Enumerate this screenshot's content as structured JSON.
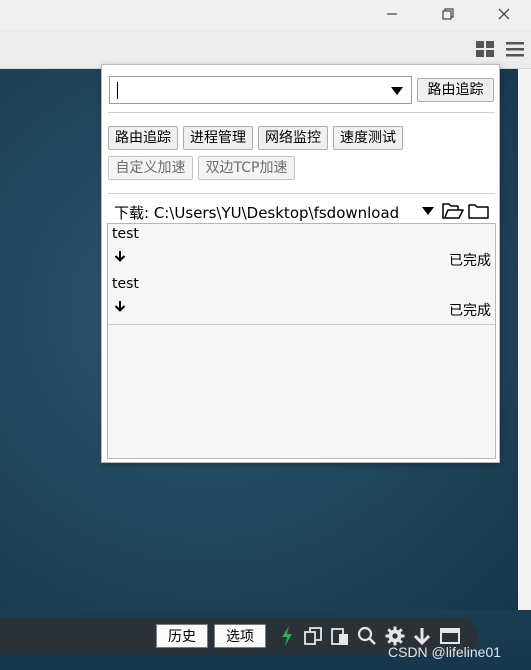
{
  "panel": {
    "route_button": "路由追踪",
    "tools": [
      "路由追踪",
      "进程管理",
      "网络监控",
      "速度测试"
    ],
    "tools_disabled": [
      "自定义加速",
      "双边TCP加速"
    ],
    "download_label": "下载: C:\\Users\\YU\\Desktop\\fsdownload",
    "items": [
      {
        "name": "test",
        "status": "已完成"
      },
      {
        "name": "test",
        "status": "已完成"
      }
    ]
  },
  "taskbar": {
    "history_label": "历史",
    "options_label": "选项"
  },
  "watermark": "CSDN @lifeline01",
  "colors": {
    "desktop": "#224a5e",
    "accent_green": "#22b14c",
    "taskbar": "#2a3238"
  }
}
